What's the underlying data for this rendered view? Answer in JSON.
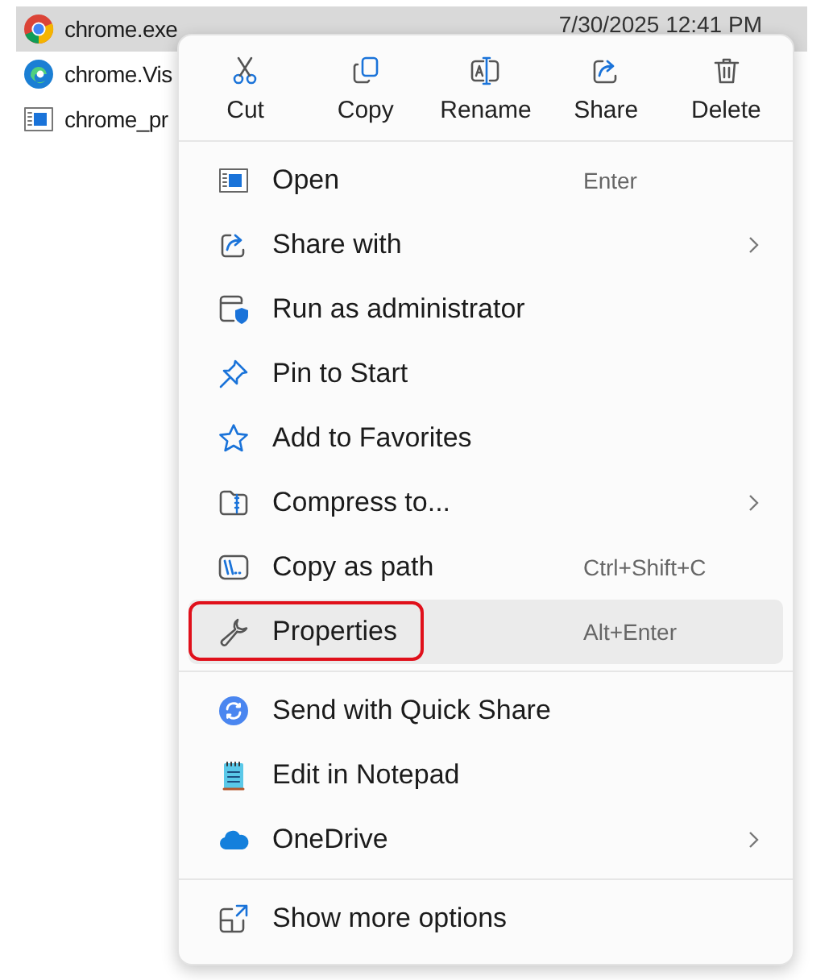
{
  "files": [
    {
      "name": "chrome.exe",
      "date": "7/30/2025 12:41 PM",
      "selected": true
    },
    {
      "name": "chrome.Vis",
      "selected": false
    },
    {
      "name": "chrome_pr",
      "selected": false
    }
  ],
  "context_menu": {
    "toolbar": [
      {
        "label": "Cut"
      },
      {
        "label": "Copy"
      },
      {
        "label": "Rename"
      },
      {
        "label": "Share"
      },
      {
        "label": "Delete"
      }
    ],
    "sections": [
      {
        "items": [
          {
            "label": "Open",
            "shortcut": "Enter",
            "has_submenu": false,
            "selected": false,
            "annotated": false
          },
          {
            "label": "Share with",
            "has_submenu": true,
            "selected": false,
            "annotated": false
          },
          {
            "label": "Run as administrator",
            "has_submenu": false,
            "selected": false,
            "annotated": false
          },
          {
            "label": "Pin to Start",
            "has_submenu": false,
            "selected": false,
            "annotated": false
          },
          {
            "label": "Add to Favorites",
            "has_submenu": false,
            "selected": false,
            "annotated": false
          },
          {
            "label": "Compress to...",
            "has_submenu": true,
            "selected": false,
            "annotated": false
          },
          {
            "label": "Copy as path",
            "shortcut": "Ctrl+Shift+C",
            "has_submenu": false,
            "selected": false,
            "annotated": false
          },
          {
            "label": "Properties",
            "shortcut": "Alt+Enter",
            "has_submenu": false,
            "selected": true,
            "annotated": true
          }
        ]
      },
      {
        "items": [
          {
            "label": "Send with Quick Share",
            "has_submenu": false,
            "selected": false,
            "annotated": false
          },
          {
            "label": "Edit in Notepad",
            "has_submenu": false,
            "selected": false,
            "annotated": false
          },
          {
            "label": "OneDrive",
            "has_submenu": true,
            "selected": false,
            "annotated": false
          }
        ]
      },
      {
        "items": [
          {
            "label": "Show more options",
            "has_submenu": false,
            "selected": false,
            "annotated": false
          }
        ]
      }
    ]
  }
}
